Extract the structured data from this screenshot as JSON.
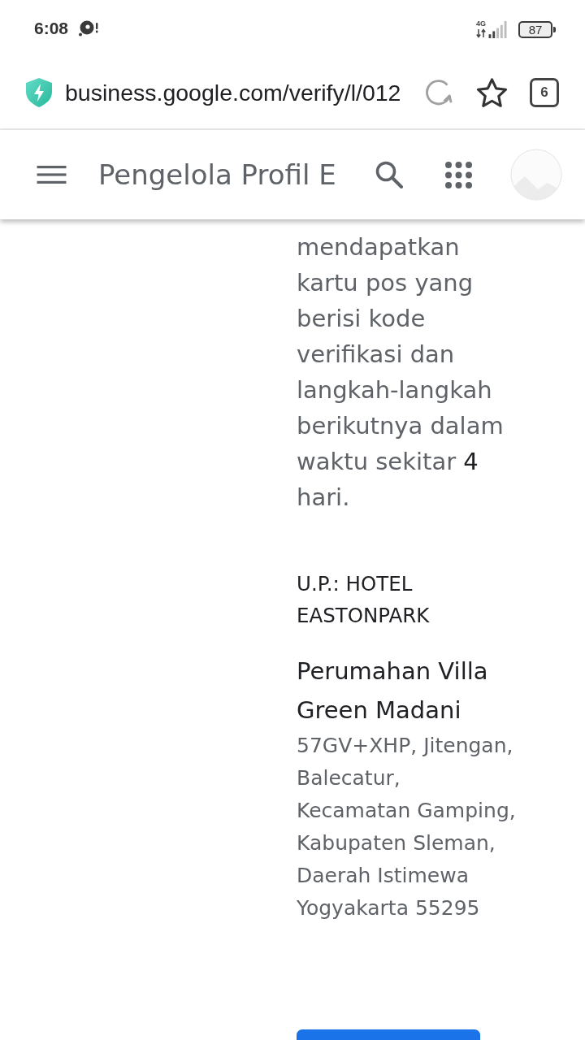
{
  "status_bar": {
    "time": "6:08",
    "network_type": "4G",
    "battery": "87"
  },
  "browser_bar": {
    "url": "business.google.com/verify/l/012",
    "tab_count": "6"
  },
  "app_bar": {
    "title": "Pengelola Profil E"
  },
  "verification": {
    "message": "mendapatkan kartu pos yang berisi kode verifikasi dan langkah-langkah berikutnya dalam waktu sekitar **4** hari.",
    "recipient": "U.P.: HOTEL EASTONPARK",
    "address_title": "Perumahan Villa Green Madani",
    "address": "57GV+XHP, Jitengan, Balecatur, Kecamatan Gamping, Kabupaten Sleman, Daerah Istimewa Yogyakarta 55295"
  }
}
